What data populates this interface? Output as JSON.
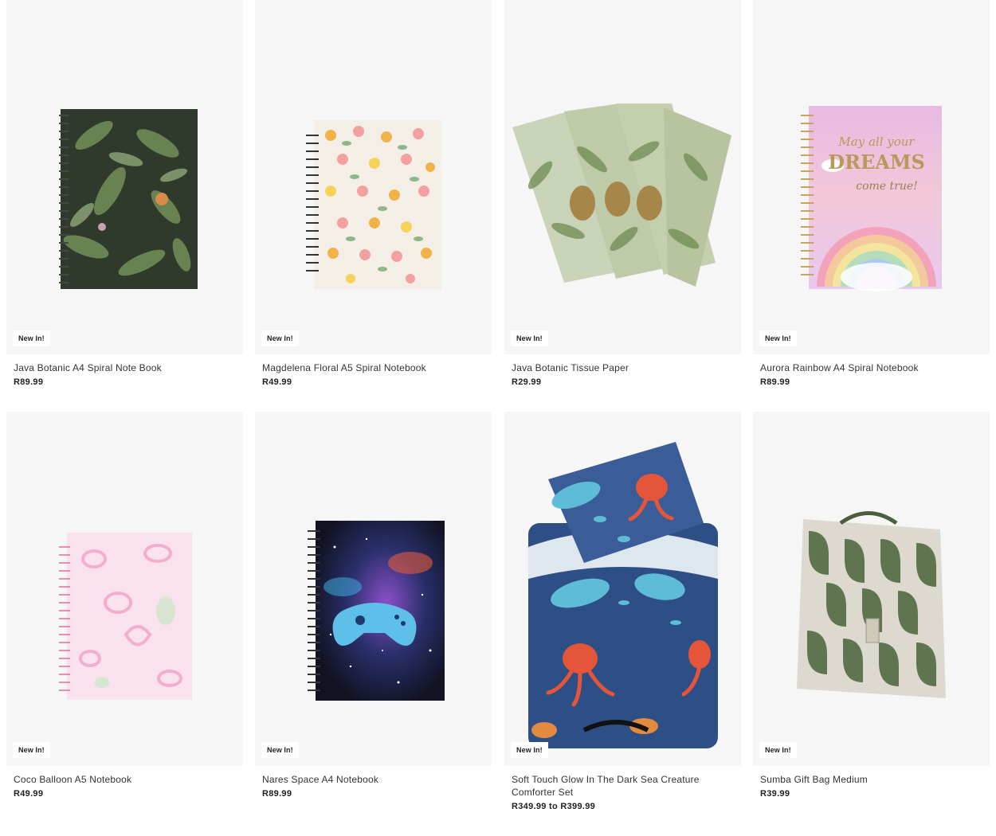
{
  "products": [
    {
      "name": "Java Botanic A4 Spiral Note Book",
      "price": "R89.99",
      "badge": "New In!",
      "image_icon": "dark-botanical-notebook-icon"
    },
    {
      "name": "Magdelena Floral A5 Spiral Notebook",
      "price": "R49.99",
      "badge": "New In!",
      "image_icon": "floral-notebook-icon"
    },
    {
      "name": "Java Botanic Tissue Paper",
      "price": "R29.99",
      "badge": "New In!",
      "image_icon": "botanic-tissue-paper-icon"
    },
    {
      "name": "Aurora Rainbow A4 Spiral Notebook",
      "price": "R89.99",
      "badge": "New In!",
      "image_icon": "rainbow-notebook-icon",
      "cover_text": "May all your DREAMS come true!"
    },
    {
      "name": "Coco Balloon A5 Notebook",
      "price": "R49.99",
      "badge": "New In!",
      "image_icon": "balloon-notebook-icon"
    },
    {
      "name": "Nares Space A4 Notebook",
      "price": "R89.99",
      "badge": "New In!",
      "image_icon": "space-gamepad-notebook-icon"
    },
    {
      "name": "Soft Touch Glow In The Dark Sea Creature Comforter Set",
      "price": "R349.99 to R399.99",
      "badge": "New In!",
      "image_icon": "sea-creature-comforter-icon"
    },
    {
      "name": "Sumba Gift Bag Medium",
      "price": "R39.99",
      "badge": "New In!",
      "image_icon": "green-gift-bag-icon"
    }
  ],
  "colors": {
    "card_bg": "#f6f6f6",
    "text": "#333333",
    "badge_bg": "#ffffff"
  }
}
